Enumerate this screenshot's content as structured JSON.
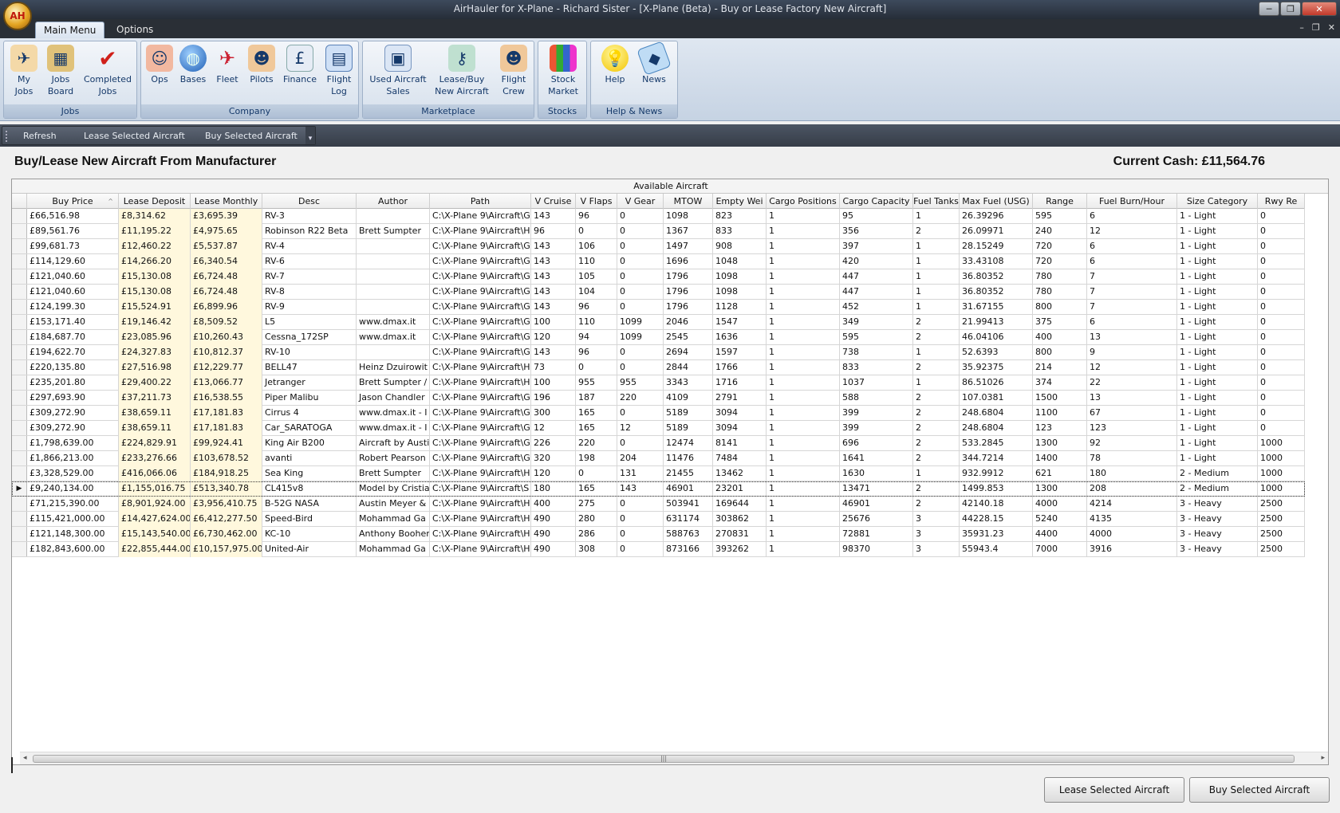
{
  "window": {
    "title": "AirHauler for X-Plane - Richard Sister - [X-Plane (Beta) - Buy or Lease Factory New Aircraft]",
    "minimize": "─",
    "restore": "❐",
    "close": "✕"
  },
  "app_orb": "AH",
  "ribbon_tabs": [
    {
      "label": "Main Menu"
    },
    {
      "label": "Options"
    }
  ],
  "mdi": {
    "minimize": "–",
    "restore": "❐",
    "close": "✕"
  },
  "ribbon_groups": {
    "jobs": {
      "label": "Jobs",
      "buttons": [
        {
          "label": "My\nJobs",
          "icon": "plane-icon"
        },
        {
          "label": "Jobs\nBoard",
          "icon": "box-icon"
        },
        {
          "label": "Completed\nJobs",
          "icon": "checkmark-icon"
        }
      ]
    },
    "company": {
      "label": "Company",
      "buttons": [
        {
          "label": "Ops",
          "icon": "person-icon"
        },
        {
          "label": "Bases",
          "icon": "globe-icon"
        },
        {
          "label": "Fleet",
          "icon": "airplane-icon"
        },
        {
          "label": "Pilots",
          "icon": "pilot-icon"
        },
        {
          "label": "Finance",
          "icon": "money-icon"
        },
        {
          "label": "Flight\nLog",
          "icon": "book-icon"
        }
      ]
    },
    "marketplace": {
      "label": "Marketplace",
      "buttons": [
        {
          "label": "Used Aircraft\nSales",
          "icon": "sales-icon"
        },
        {
          "label": "Lease/Buy\nNew Aircraft",
          "icon": "keys-icon"
        },
        {
          "label": "Flight\nCrew",
          "icon": "crew-icon"
        }
      ]
    },
    "stocks": {
      "label": "Stocks",
      "buttons": [
        {
          "label": "Stock\nMarket",
          "icon": "books-icon"
        }
      ]
    },
    "help": {
      "label": "Help & News",
      "buttons": [
        {
          "label": "Help",
          "icon": "lightbulb-icon"
        },
        {
          "label": "News",
          "icon": "news-icon"
        }
      ]
    }
  },
  "toolbar": {
    "refresh": "Refresh",
    "lease": "Lease Selected Aircraft",
    "buy": "Buy Selected Aircraft",
    "overflow": "▾"
  },
  "page": {
    "title": "Buy/Lease New Aircraft From Manufacturer",
    "cash": "Current Cash: £11,564.76"
  },
  "grid": {
    "caption": "Available Aircraft",
    "sort_indicator": "^",
    "selected_marker": "▶",
    "columns": [
      "Buy Price",
      "Lease Deposit",
      "Lease Monthly",
      "Desc",
      "Author",
      "Path",
      "V Cruise",
      "V Flaps",
      "V Gear",
      "MTOW",
      "Empty Wei",
      "Cargo Positions",
      "Cargo Capacity",
      "Fuel Tanks",
      "Max Fuel (USG)",
      "Range",
      "Fuel Burn/Hour",
      "Size Category",
      "Rwy Re"
    ],
    "rows": [
      [
        "£66,516.98",
        "£8,314.62",
        "£3,695.39",
        "RV-3",
        "",
        "C:\\X-Plane 9\\Aircraft\\G",
        "143",
        "96",
        "0",
        "1098",
        "823",
        "1",
        "95",
        "1",
        "26.39296",
        "595",
        "6",
        "1 - Light",
        "0"
      ],
      [
        "£89,561.76",
        "£11,195.22",
        "£4,975.65",
        "Robinson R22 Beta",
        "Brett Sumpter",
        "C:\\X-Plane 9\\Aircraft\\H",
        "96",
        "0",
        "0",
        "1367",
        "833",
        "1",
        "356",
        "2",
        "26.09971",
        "240",
        "12",
        "1 - Light",
        "0"
      ],
      [
        "£99,681.73",
        "£12,460.22",
        "£5,537.87",
        "RV-4",
        "",
        "C:\\X-Plane 9\\Aircraft\\G",
        "143",
        "106",
        "0",
        "1497",
        "908",
        "1",
        "397",
        "1",
        "28.15249",
        "720",
        "6",
        "1 - Light",
        "0"
      ],
      [
        "£114,129.60",
        "£14,266.20",
        "£6,340.54",
        "RV-6",
        "",
        "C:\\X-Plane 9\\Aircraft\\G",
        "143",
        "110",
        "0",
        "1696",
        "1048",
        "1",
        "420",
        "1",
        "33.43108",
        "720",
        "6",
        "1 - Light",
        "0"
      ],
      [
        "£121,040.60",
        "£15,130.08",
        "£6,724.48",
        "RV-7",
        "",
        "C:\\X-Plane 9\\Aircraft\\G",
        "143",
        "105",
        "0",
        "1796",
        "1098",
        "1",
        "447",
        "1",
        "36.80352",
        "780",
        "7",
        "1 - Light",
        "0"
      ],
      [
        "£121,040.60",
        "£15,130.08",
        "£6,724.48",
        "RV-8",
        "",
        "C:\\X-Plane 9\\Aircraft\\G",
        "143",
        "104",
        "0",
        "1796",
        "1098",
        "1",
        "447",
        "1",
        "36.80352",
        "780",
        "7",
        "1 - Light",
        "0"
      ],
      [
        "£124,199.30",
        "£15,524.91",
        "£6,899.96",
        "RV-9",
        "",
        "C:\\X-Plane 9\\Aircraft\\G",
        "143",
        "96",
        "0",
        "1796",
        "1128",
        "1",
        "452",
        "1",
        "31.67155",
        "800",
        "7",
        "1 - Light",
        "0"
      ],
      [
        "£153,171.40",
        "£19,146.42",
        "£8,509.52",
        "L5",
        "www.dmax.it",
        "C:\\X-Plane 9\\Aircraft\\G",
        "100",
        "110",
        "1099",
        "2046",
        "1547",
        "1",
        "349",
        "2",
        "21.99413",
        "375",
        "6",
        "1 - Light",
        "0"
      ],
      [
        "£184,687.70",
        "£23,085.96",
        "£10,260.43",
        "Cessna_172SP",
        "www.dmax.it",
        "C:\\X-Plane 9\\Aircraft\\G",
        "120",
        "94",
        "1099",
        "2545",
        "1636",
        "1",
        "595",
        "2",
        "46.04106",
        "400",
        "13",
        "1 - Light",
        "0"
      ],
      [
        "£194,622.70",
        "£24,327.83",
        "£10,812.37",
        "RV-10",
        "",
        "C:\\X-Plane 9\\Aircraft\\G",
        "143",
        "96",
        "0",
        "2694",
        "1597",
        "1",
        "738",
        "1",
        "52.6393",
        "800",
        "9",
        "1 - Light",
        "0"
      ],
      [
        "£220,135.80",
        "£27,516.98",
        "£12,229.77",
        "BELL47",
        "Heinz Dzuirowit",
        "C:\\X-Plane 9\\Aircraft\\H",
        "73",
        "0",
        "0",
        "2844",
        "1766",
        "1",
        "833",
        "2",
        "35.92375",
        "214",
        "12",
        "1 - Light",
        "0"
      ],
      [
        "£235,201.80",
        "£29,400.22",
        "£13,066.77",
        "Jetranger",
        "Brett Sumpter /",
        "C:\\X-Plane 9\\Aircraft\\H",
        "100",
        "955",
        "955",
        "3343",
        "1716",
        "1",
        "1037",
        "1",
        "86.51026",
        "374",
        "22",
        "1 - Light",
        "0"
      ],
      [
        "£297,693.90",
        "£37,211.73",
        "£16,538.55",
        "Piper Malibu",
        "Jason Chandler",
        "C:\\X-Plane 9\\Aircraft\\G",
        "196",
        "187",
        "220",
        "4109",
        "2791",
        "1",
        "588",
        "2",
        "107.0381",
        "1500",
        "13",
        "1 - Light",
        "0"
      ],
      [
        "£309,272.90",
        "£38,659.11",
        "£17,181.83",
        "Cirrus 4",
        "www.dmax.it - I",
        "C:\\X-Plane 9\\Aircraft\\G",
        "300",
        "165",
        "0",
        "5189",
        "3094",
        "1",
        "399",
        "2",
        "248.6804",
        "1100",
        "67",
        "1 - Light",
        "0"
      ],
      [
        "£309,272.90",
        "£38,659.11",
        "£17,181.83",
        "Car_SARATOGA",
        "www.dmax.it - I",
        "C:\\X-Plane 9\\Aircraft\\G",
        "12",
        "165",
        "12",
        "5189",
        "3094",
        "1",
        "399",
        "2",
        "248.6804",
        "123",
        "123",
        "1 - Light",
        "0"
      ],
      [
        "£1,798,639.00",
        "£224,829.91",
        "£99,924.41",
        "King Air B200",
        "Aircraft by Austi",
        "C:\\X-Plane 9\\Aircraft\\G",
        "226",
        "220",
        "0",
        "12474",
        "8141",
        "1",
        "696",
        "2",
        "533.2845",
        "1300",
        "92",
        "1 - Light",
        "1000"
      ],
      [
        "£1,866,213.00",
        "£233,276.66",
        "£103,678.52",
        "avanti",
        "Robert Pearson",
        "C:\\X-Plane 9\\Aircraft\\G",
        "320",
        "198",
        "204",
        "11476",
        "7484",
        "1",
        "1641",
        "2",
        "344.7214",
        "1400",
        "78",
        "1 - Light",
        "1000"
      ],
      [
        "£3,328,529.00",
        "£416,066.06",
        "£184,918.25",
        "Sea King",
        "Brett Sumpter",
        "C:\\X-Plane 9\\Aircraft\\H",
        "120",
        "0",
        "131",
        "21455",
        "13462",
        "1",
        "1630",
        "1",
        "932.9912",
        "621",
        "180",
        "2 - Medium",
        "1000"
      ],
      [
        "£9,240,134.00",
        "£1,155,016.75",
        "£513,340.78",
        "CL415v8",
        "Model by Cristia",
        "C:\\X-Plane 9\\Aircraft\\S",
        "180",
        "165",
        "143",
        "46901",
        "23201",
        "1",
        "13471",
        "2",
        "1499.853",
        "1300",
        "208",
        "2 - Medium",
        "1000"
      ],
      [
        "£71,215,390.00",
        "£8,901,924.00",
        "£3,956,410.75",
        "B-52G NASA",
        "Austin Meyer &",
        "C:\\X-Plane 9\\Aircraft\\H",
        "400",
        "275",
        "0",
        "503941",
        "169644",
        "1",
        "46901",
        "2",
        "42140.18",
        "4000",
        "4214",
        "3 - Heavy",
        "2500"
      ],
      [
        "£115,421,000.00",
        "£14,427,624.00",
        "£6,412,277.50",
        "Speed-Bird",
        "Mohammad Ga",
        "C:\\X-Plane 9\\Aircraft\\H",
        "490",
        "280",
        "0",
        "631174",
        "303862",
        "1",
        "25676",
        "3",
        "44228.15",
        "5240",
        "4135",
        "3 - Heavy",
        "2500"
      ],
      [
        "£121,148,300.00",
        "£15,143,540.00",
        "£6,730,462.00",
        "KC-10",
        "Anthony Booher",
        "C:\\X-Plane 9\\Aircraft\\H",
        "490",
        "286",
        "0",
        "588763",
        "270831",
        "1",
        "72881",
        "3",
        "35931.23",
        "4400",
        "4000",
        "3 - Heavy",
        "2500"
      ],
      [
        "£182,843,600.00",
        "£22,855,444.00",
        "£10,157,975.00",
        "United-Air",
        "Mohammad Ga",
        "C:\\X-Plane 9\\Aircraft\\H",
        "490",
        "308",
        "0",
        "873166",
        "393262",
        "1",
        "98370",
        "3",
        "55943.4",
        "7000",
        "3916",
        "3 - Heavy",
        "2500"
      ]
    ],
    "selected_row": 18
  },
  "scroll": {
    "left": "◂",
    "right": "▸",
    "grip": "|||"
  },
  "buttons": {
    "lease": "Lease Selected Aircraft",
    "buy": "Buy Selected Aircraft"
  }
}
